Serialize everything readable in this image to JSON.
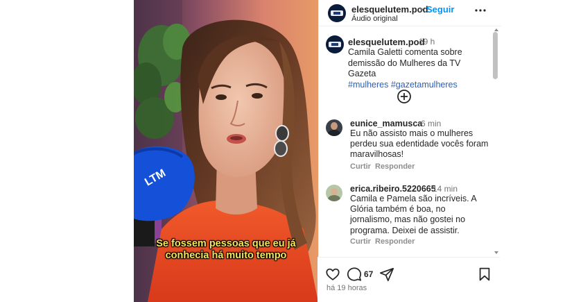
{
  "header": {
    "username": "elesquelutem.pod",
    "separator": "•",
    "follow_label": "Seguir",
    "audio_label": "Áudio original",
    "more_icon": "more-horizontal-icon"
  },
  "caption": {
    "username": "elesquelutem.pod",
    "time": "19 h",
    "text": "Camila Galetti comenta sobre demissão do Mulheres da TV Gazeta",
    "hashtags": "#mulheres #gazetamulheres"
  },
  "load_more_icon": "plus-circle-icon",
  "comments": [
    {
      "username": "eunice_mamusca",
      "time": "6 min",
      "text": "Eu não assisto mais o mulheres perdeu sua edentidade vocês foram maravilhosas!",
      "like_label": "Curtir",
      "reply_label": "Responder"
    },
    {
      "username": "erica.ribeiro.5220665",
      "time": "14 min",
      "text": "Camila e Pamela são incríveis. A Glória também é boa, no jornalismo, mas não gostei no programa. Deixei de assistir.",
      "like_label": "Curtir",
      "reply_label": "Responder"
    }
  ],
  "video": {
    "subtitle_line1": "Se fossem pessoas que eu já",
    "subtitle_line2": "conhecia há muito tempo",
    "mic_logo": "LTM"
  },
  "footer": {
    "comment_count": "67",
    "posted_ago": "há 19 horas",
    "icons": [
      "heart-icon",
      "comment-icon",
      "share-icon",
      "bookmark-icon"
    ]
  },
  "colors": {
    "link_blue": "#0095f6",
    "hashtag_blue": "#2b5db7",
    "subtitle_yellow": "#f6e65a",
    "mic_blue": "#1450d8",
    "shirt_orange": "#e8431f"
  }
}
